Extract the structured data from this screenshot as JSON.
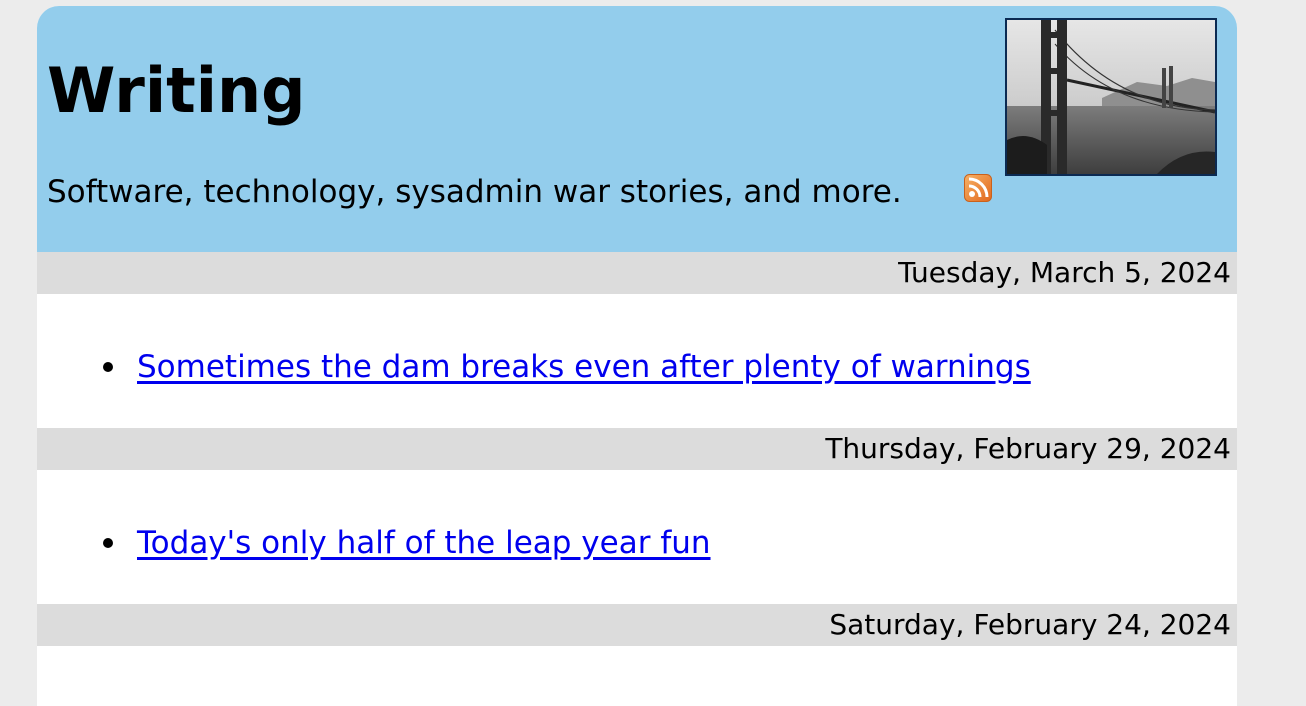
{
  "header": {
    "title": "Writing",
    "tagline": "Software, technology, sysadmin war stories, and more.",
    "feed_icon": "rss-feed-icon",
    "photo_icon": "golden-gate-bridge-photo",
    "colors": {
      "header_bg": "#93cdec",
      "date_bar_bg": "#dcdcdc",
      "link": "#0000ee",
      "rss": "#f08a24"
    }
  },
  "days": [
    {
      "date": "Tuesday, March 5, 2024",
      "posts": [
        {
          "title": "Sometimes the dam breaks even after plenty of warnings"
        }
      ]
    },
    {
      "date": "Thursday, February 29, 2024",
      "posts": [
        {
          "title": "Today's only half of the leap year fun"
        }
      ]
    },
    {
      "date": "Saturday, February 24, 2024",
      "posts": []
    }
  ]
}
